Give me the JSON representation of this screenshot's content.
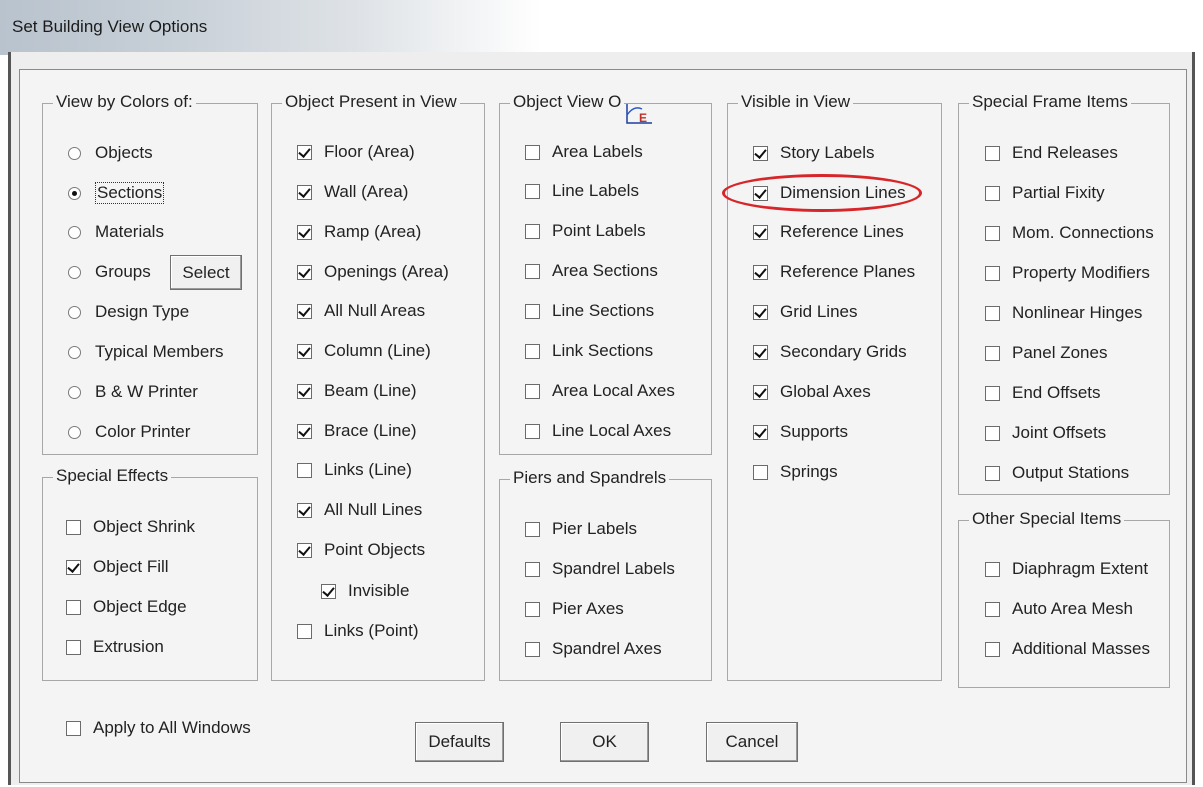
{
  "window": {
    "title": "Set Building View Options"
  },
  "view_by_colors": {
    "title": "View by Colors of:",
    "options": [
      {
        "label": "Objects",
        "checked": false
      },
      {
        "label": "Sections",
        "checked": true
      },
      {
        "label": "Materials",
        "checked": false
      },
      {
        "label": "Groups",
        "checked": false
      },
      {
        "label": "Design Type",
        "checked": false
      },
      {
        "label": "Typical Members",
        "checked": false
      },
      {
        "label": "B & W Printer",
        "checked": false
      },
      {
        "label": "Color Printer",
        "checked": false
      }
    ],
    "select_label": "Select"
  },
  "special_effects": {
    "title": "Special Effects",
    "items": [
      {
        "label": "Object Shrink",
        "checked": false
      },
      {
        "label": "Object Fill",
        "checked": true
      },
      {
        "label": "Object Edge",
        "checked": false
      },
      {
        "label": "Extrusion",
        "checked": false
      }
    ]
  },
  "object_present": {
    "title": "Object Present in View",
    "items": [
      {
        "label": "Floor (Area)",
        "checked": true
      },
      {
        "label": "Wall (Area)",
        "checked": true
      },
      {
        "label": "Ramp (Area)",
        "checked": true
      },
      {
        "label": "Openings (Area)",
        "checked": true
      },
      {
        "label": "All Null Areas",
        "checked": true
      },
      {
        "label": "Column (Line)",
        "checked": true
      },
      {
        "label": "Beam (Line)",
        "checked": true
      },
      {
        "label": "Brace (Line)",
        "checked": true
      },
      {
        "label": "Links (Line)",
        "checked": false
      },
      {
        "label": "All Null Lines",
        "checked": true
      },
      {
        "label": "Point Objects",
        "checked": true
      },
      {
        "label": "Invisible",
        "checked": true
      },
      {
        "label": "Links (Point)",
        "checked": false
      }
    ]
  },
  "object_view": {
    "title": "Object View O",
    "items": [
      {
        "label": "Area Labels",
        "checked": false
      },
      {
        "label": "Line Labels",
        "checked": false
      },
      {
        "label": "Point Labels",
        "checked": false
      },
      {
        "label": "Area Sections",
        "checked": false
      },
      {
        "label": "Line Sections",
        "checked": false
      },
      {
        "label": "Link Sections",
        "checked": false
      },
      {
        "label": "Area Local Axes",
        "checked": false
      },
      {
        "label": "Line Local Axes",
        "checked": false
      }
    ]
  },
  "piers_spandrels": {
    "title": "Piers and Spandrels",
    "items": [
      {
        "label": "Pier Labels",
        "checked": false
      },
      {
        "label": "Spandrel Labels",
        "checked": false
      },
      {
        "label": "Pier Axes",
        "checked": false
      },
      {
        "label": "Spandrel Axes",
        "checked": false
      }
    ]
  },
  "visible_in_view": {
    "title": "Visible in View",
    "items": [
      {
        "label": "Story Labels",
        "checked": true
      },
      {
        "label": "Dimension Lines",
        "checked": true
      },
      {
        "label": "Reference Lines",
        "checked": true
      },
      {
        "label": "Reference Planes",
        "checked": true
      },
      {
        "label": "Grid Lines",
        "checked": true
      },
      {
        "label": "Secondary Grids",
        "checked": true
      },
      {
        "label": "Global Axes",
        "checked": true
      },
      {
        "label": "Supports",
        "checked": true
      },
      {
        "label": "Springs",
        "checked": false
      }
    ]
  },
  "special_frame": {
    "title": "Special Frame Items",
    "items": [
      {
        "label": "End Releases",
        "checked": false
      },
      {
        "label": "Partial Fixity",
        "checked": false
      },
      {
        "label": "Mom. Connections",
        "checked": false
      },
      {
        "label": "Property Modifiers",
        "checked": false
      },
      {
        "label": "Nonlinear Hinges",
        "checked": false
      },
      {
        "label": "Panel Zones",
        "checked": false
      },
      {
        "label": "End Offsets",
        "checked": false
      },
      {
        "label": "Joint Offsets",
        "checked": false
      },
      {
        "label": "Output Stations",
        "checked": false
      }
    ]
  },
  "other_special": {
    "title": "Other Special Items",
    "items": [
      {
        "label": "Diaphragm Extent",
        "checked": false
      },
      {
        "label": "Auto Area Mesh",
        "checked": false
      },
      {
        "label": "Additional Masses",
        "checked": false
      }
    ]
  },
  "footer": {
    "apply_all": {
      "label": "Apply to All Windows",
      "checked": false
    },
    "defaults_label": "Defaults",
    "ok_label": "OK",
    "cancel_label": "Cancel"
  }
}
